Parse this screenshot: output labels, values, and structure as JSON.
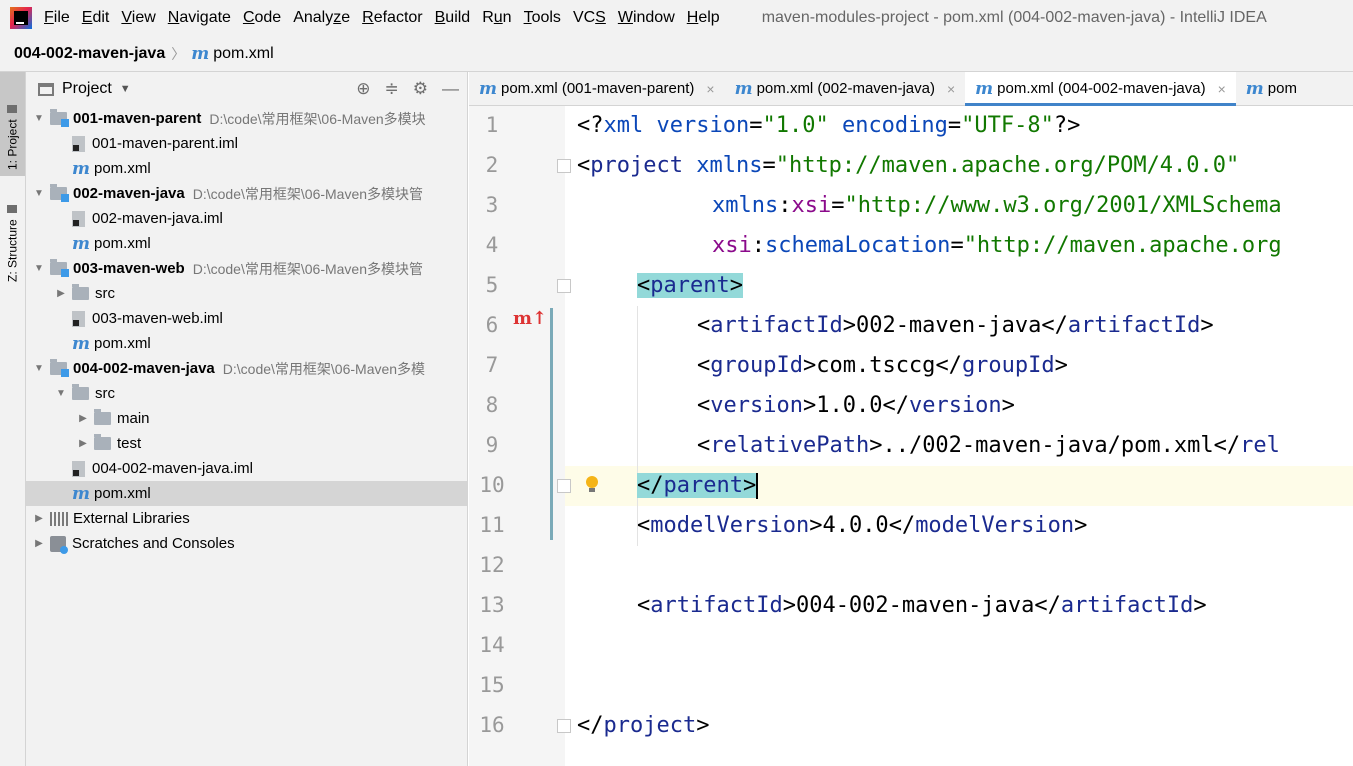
{
  "menubar": {
    "items": [
      {
        "label": "File",
        "key": "F"
      },
      {
        "label": "Edit",
        "key": "E"
      },
      {
        "label": "View",
        "key": "V"
      },
      {
        "label": "Navigate",
        "key": "N"
      },
      {
        "label": "Code",
        "key": "C"
      },
      {
        "label": "Analyze",
        "key": "z"
      },
      {
        "label": "Refactor",
        "key": "R"
      },
      {
        "label": "Build",
        "key": "B"
      },
      {
        "label": "Run",
        "key": "u"
      },
      {
        "label": "Tools",
        "key": "T"
      },
      {
        "label": "VCS",
        "key": "S"
      },
      {
        "label": "Window",
        "key": "W"
      },
      {
        "label": "Help",
        "key": "H"
      }
    ],
    "window_title": "maven-modules-project - pom.xml (004-002-maven-java) - IntelliJ IDEA"
  },
  "breadcrumb": {
    "project": "004-002-maven-java",
    "file": "pom.xml",
    "file_icon": "m"
  },
  "toolstrip": {
    "project_tab": "1: Project",
    "structure_tab": "Z: Structure"
  },
  "project_panel": {
    "title": "Project",
    "tree": [
      {
        "label": "001-maven-parent",
        "path": "D:\\code\\常用框架\\06-Maven多模块",
        "type": "module",
        "depth": 0,
        "arrow": "down",
        "bold": true
      },
      {
        "label": "001-maven-parent.iml",
        "type": "iml",
        "depth": 1
      },
      {
        "label": "pom.xml",
        "type": "pom",
        "depth": 1
      },
      {
        "label": "002-maven-java",
        "path": "D:\\code\\常用框架\\06-Maven多模块管",
        "type": "module",
        "depth": 0,
        "arrow": "down",
        "bold": true
      },
      {
        "label": "002-maven-java.iml",
        "type": "iml",
        "depth": 1
      },
      {
        "label": "pom.xml",
        "type": "pom",
        "depth": 1
      },
      {
        "label": "003-maven-web",
        "path": "D:\\code\\常用框架\\06-Maven多模块管",
        "type": "module",
        "depth": 0,
        "arrow": "down",
        "bold": true
      },
      {
        "label": "src",
        "type": "folder",
        "depth": 1,
        "arrow": "right"
      },
      {
        "label": "003-maven-web.iml",
        "type": "iml",
        "depth": 1
      },
      {
        "label": "pom.xml",
        "type": "pom",
        "depth": 1
      },
      {
        "label": "004-002-maven-java",
        "path": "D:\\code\\常用框架\\06-Maven多模",
        "type": "module",
        "depth": 0,
        "arrow": "down",
        "bold": true
      },
      {
        "label": "src",
        "type": "folder",
        "depth": 1,
        "arrow": "down"
      },
      {
        "label": "main",
        "type": "folder",
        "depth": 2,
        "arrow": "right"
      },
      {
        "label": "test",
        "type": "folder",
        "depth": 2,
        "arrow": "right"
      },
      {
        "label": "004-002-maven-java.iml",
        "type": "iml",
        "depth": 1
      },
      {
        "label": "pom.xml",
        "type": "pom",
        "depth": 1,
        "selected": true
      },
      {
        "label": "External Libraries",
        "type": "lib",
        "depth": 0,
        "arrow": "right"
      },
      {
        "label": "Scratches and Consoles",
        "type": "scratch",
        "depth": 0,
        "arrow": "right"
      }
    ]
  },
  "editor": {
    "tabs": [
      {
        "label": "pom.xml (001-maven-parent)",
        "active": false
      },
      {
        "label": "pom.xml (002-maven-java)",
        "active": false
      },
      {
        "label": "pom.xml (004-002-maven-java)",
        "active": true
      },
      {
        "label": "pom",
        "active": false
      }
    ],
    "close_glyph": "×",
    "line_numbers": [
      "1",
      "2",
      "3",
      "4",
      "5",
      "6",
      "7",
      "8",
      "9",
      "10",
      "11",
      "12",
      "13",
      "14",
      "15",
      "16"
    ],
    "lines": {
      "l1": {
        "a": "<?",
        "b": "xml",
        "c": " version",
        "d": "=",
        "e": "\"1.0\"",
        "f": " encoding",
        "g": "=",
        "h": "\"UTF-8\"",
        "i": "?>"
      },
      "l2": {
        "a": "<",
        "b": "project",
        "c": " xmlns",
        "d": "=",
        "e": "\"http://maven.apache.org/POM/4.0.0\""
      },
      "l3": {
        "a": "xmlns",
        "b": ":",
        "c": "xsi",
        "d": "=",
        "e": "\"http://www.w3.org/2001/XMLSchema"
      },
      "l4": {
        "a": "xsi",
        "b": ":",
        "c": "schemaLocation",
        "d": "=",
        "e": "\"http://maven.apache.org"
      },
      "l5": {
        "a": "<",
        "b": "parent",
        "c": ">"
      },
      "l6": {
        "a": "<",
        "b": "artifactId",
        "c": ">",
        "d": "002-maven-java",
        "e": "</",
        "f": "artifactId",
        "g": ">"
      },
      "l7": {
        "a": "<",
        "b": "groupId",
        "c": ">",
        "d": "com.tsccg",
        "e": "</",
        "f": "groupId",
        "g": ">"
      },
      "l8": {
        "a": "<",
        "b": "version",
        "c": ">",
        "d": "1.0.0",
        "e": "</",
        "f": "version",
        "g": ">"
      },
      "l9": {
        "a": "<",
        "b": "relativePath",
        "c": ">",
        "d": "../002-maven-java/pom.xml",
        "e": "</",
        "f": "rel"
      },
      "l10": {
        "a": "</",
        "b": "parent",
        "c": ">"
      },
      "l11": {
        "a": "<",
        "b": "modelVersion",
        "c": ">",
        "d": "4.0.0",
        "e": "</",
        "f": "modelVersion",
        "g": ">"
      },
      "l13": {
        "a": "<",
        "b": "artifactId",
        "c": ">",
        "d": "004-002-maven-java",
        "e": "</",
        "f": "artifactId",
        "g": ">"
      },
      "l16": {
        "a": "</",
        "b": "project",
        "c": ">"
      }
    },
    "gutter_icons": {
      "override": "m",
      "override_arrow": "↑"
    },
    "current_line": 10
  }
}
